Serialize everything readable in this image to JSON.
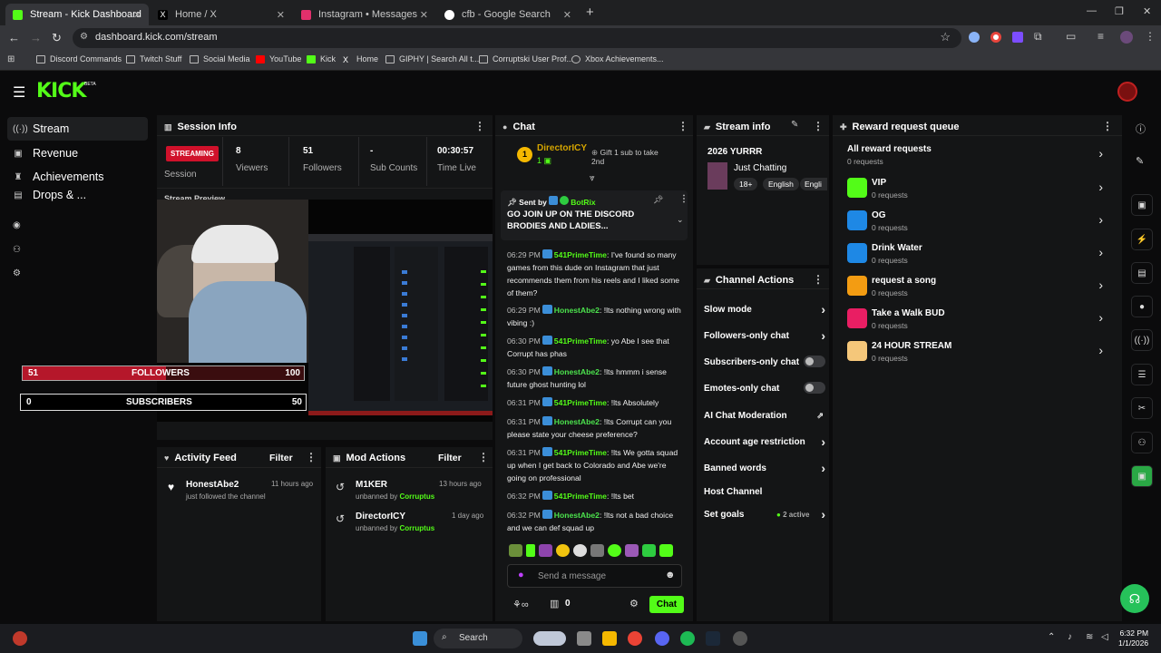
{
  "browser": {
    "tabs": [
      {
        "title": "Stream - Kick Dashboard",
        "color": "#53fc18"
      },
      {
        "title": "Home / X",
        "color": "#000000"
      },
      {
        "title": "Instagram • Messages",
        "color": "#e1306c"
      },
      {
        "title": "cfb - Google Search",
        "color": "#4285f4"
      }
    ],
    "url": "dashboard.kick.com/stream",
    "bookmarks": [
      "Discord Commands",
      "Twitch Stuff",
      "Social Media",
      "YouTube",
      "Kick",
      "Home",
      "GIPHY | Search All t...",
      "Corruptski User Prof...",
      "Xbox Achievements..."
    ]
  },
  "header": {
    "logo": "KICK",
    "beta": "BETA"
  },
  "nav": {
    "items": [
      {
        "label": "Stream",
        "icon": "broadcast-icon"
      },
      {
        "label": "Revenue",
        "icon": "revenue-icon"
      },
      {
        "label": "Achievements",
        "icon": "trophy-icon"
      },
      {
        "label": "Drops & ...",
        "icon": "gift-icon"
      }
    ]
  },
  "session": {
    "title": "Session Info",
    "status": "STREAMING",
    "status_label": "Session",
    "stats": [
      {
        "value": "8",
        "label": "Viewers"
      },
      {
        "value": "51",
        "label": "Followers"
      },
      {
        "value": "-",
        "label": "Sub Counts"
      },
      {
        "value": "00:30:57",
        "label": "Time Live"
      }
    ],
    "preview_title": "Stream Preview"
  },
  "preview": {
    "followers_current": "51",
    "followers_label": "FOLLOWERS",
    "followers_goal": "100",
    "followers_progress": 0.51,
    "subs_current": "0",
    "subs_label": "SUBSCRIBERS",
    "subs_goal": "50",
    "subs_progress": 0
  },
  "activity": {
    "title": "Activity Feed",
    "filter": "Filter",
    "items": [
      {
        "user": "HonestAbe2",
        "text": "just followed the channel",
        "time": "11 hours ago"
      }
    ]
  },
  "mod": {
    "title": "Mod Actions",
    "filter": "Filter",
    "items": [
      {
        "user": "M1KER",
        "text": "unbanned by",
        "by": "Corruptus",
        "time": "13 hours ago"
      },
      {
        "user": "DirectorICY",
        "text": "unbanned by",
        "by": "Corruptus",
        "time": "1 day ago"
      }
    ]
  },
  "chat": {
    "title": "Chat",
    "top_gifter": "DirectorICY",
    "top_gifter_count": "1",
    "gift_text": "Gift 1 sub to take 2nd",
    "pinned_label": "Sent by",
    "pinned_by": "BotRix",
    "pinned_text": "GO JOIN UP ON THE DISCORD BRODIES AND LADIES...",
    "messages": [
      {
        "time": "06:29 PM",
        "user": "541PrimeTime",
        "text": "I've found so many games from this dude on Instagram that just recommends them from his reels and I liked some of them?"
      },
      {
        "time": "06:29 PM",
        "user": "HonestAbe2",
        "text": "!lts nothing wrong with vibing :)"
      },
      {
        "time": "06:30 PM",
        "user": "541PrimeTime",
        "text": "yo Abe I see that Corrupt has phas"
      },
      {
        "time": "06:30 PM",
        "user": "HonestAbe2",
        "text": "!lts hmmm i sense future ghost hunting lol"
      },
      {
        "time": "06:31 PM",
        "user": "541PrimeTime",
        "text": "!lts Absolutely"
      },
      {
        "time": "06:31 PM",
        "user": "HonestAbe2",
        "text": "!lts Corrupt can you please state your cheese preference?"
      },
      {
        "time": "06:31 PM",
        "user": "541PrimeTime",
        "text": "!lts We gotta squad up when I get back to Colorado and Abe we're going on professional"
      },
      {
        "time": "06:32 PM",
        "user": "541PrimeTime",
        "text": "!lts bet"
      },
      {
        "time": "06:32 PM",
        "user": "HonestAbe2",
        "text": "!lts not a bad choice and we can def squad up"
      }
    ],
    "input_placeholder": "Send a message",
    "points": "0",
    "send_label": "Chat"
  },
  "stream_info": {
    "title": "Stream info",
    "stream_title": "2026 YURRR",
    "category": "Just Chatting",
    "tags": [
      "18+",
      "English",
      "Engli"
    ]
  },
  "channel_actions": {
    "title": "Channel Actions",
    "items": [
      {
        "label": "Slow mode",
        "kind": "arrow"
      },
      {
        "label": "Followers-only chat",
        "kind": "arrow"
      },
      {
        "label": "Subscribers-only chat",
        "kind": "toggle"
      },
      {
        "label": "Emotes-only chat",
        "kind": "toggle"
      },
      {
        "label": "AI Chat Moderation",
        "kind": "external"
      },
      {
        "label": "Account age restriction",
        "kind": "arrow"
      },
      {
        "label": "Banned words",
        "kind": "arrow"
      },
      {
        "label": "Host Channel",
        "kind": "none"
      },
      {
        "label": "Set goals",
        "kind": "arrow",
        "badge": "2 active"
      }
    ]
  },
  "rewards": {
    "title": "Reward request queue",
    "items": [
      {
        "name": "All reward requests",
        "count": "0 requests",
        "color": ""
      },
      {
        "name": "VIP",
        "count": "0 requests",
        "color": "#53fc18"
      },
      {
        "name": "OG",
        "count": "0 requests",
        "color": "#1e88e5"
      },
      {
        "name": "Drink Water",
        "count": "0 requests",
        "color": "#1e88e5"
      },
      {
        "name": "request a song",
        "count": "0 requests",
        "color": "#f39c12"
      },
      {
        "name": "Take a Walk BUD",
        "count": "0 requests",
        "color": "#e91e63"
      },
      {
        "name": "24 HOUR STREAM",
        "count": "0 requests",
        "color": "#f5c77a"
      }
    ]
  },
  "taskbar": {
    "search": "Search",
    "time": "6:32 PM",
    "date": "1/1/2026"
  }
}
